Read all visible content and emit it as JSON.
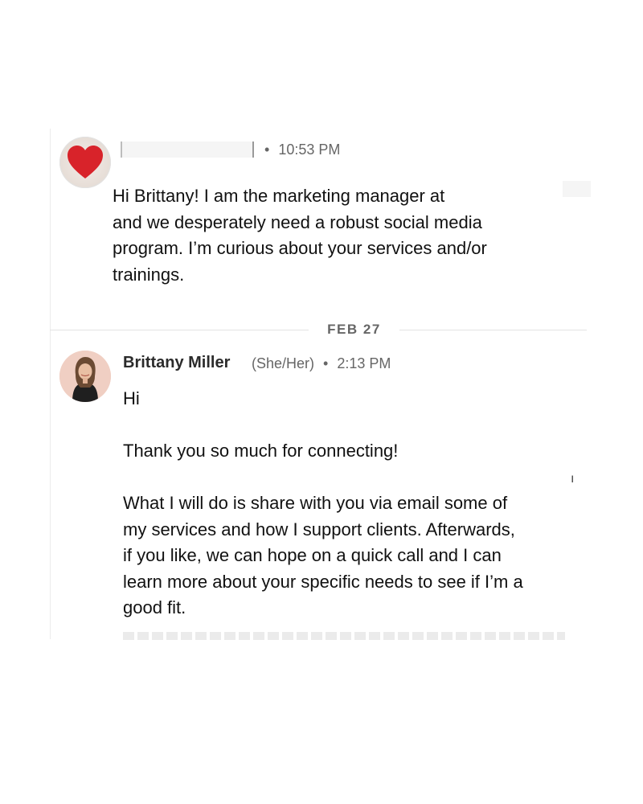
{
  "thread": {
    "message_1": {
      "timestamp": "10:53 PM",
      "text": "Hi Brittany! I am the marketing manager at\nand we desperately need a robust social media\nprogram. I’m curious about your services and/or\ntrainings."
    },
    "date_divider": "FEB 27",
    "message_2": {
      "sender_name": "Brittany Miller",
      "pronouns": "(She/Her)",
      "timestamp": "2:13 PM",
      "text": "Hi                              !\n\nThank you so much for connecting!\n\nWhat I will do is share with you via email some of\nmy services and how I support clients. Afterwards,\nif you like, we can hope on a quick call and I can\nlearn more about your specific needs to see if I’m a\ngood fit."
    },
    "separator_dot": "•",
    "colors": {
      "heart": "#d8232a",
      "meta_text": "#666666",
      "divider": "#e3e3e3"
    },
    "icons": {
      "avatar_1": "heart-icon",
      "avatar_2": "profile-photo"
    }
  }
}
